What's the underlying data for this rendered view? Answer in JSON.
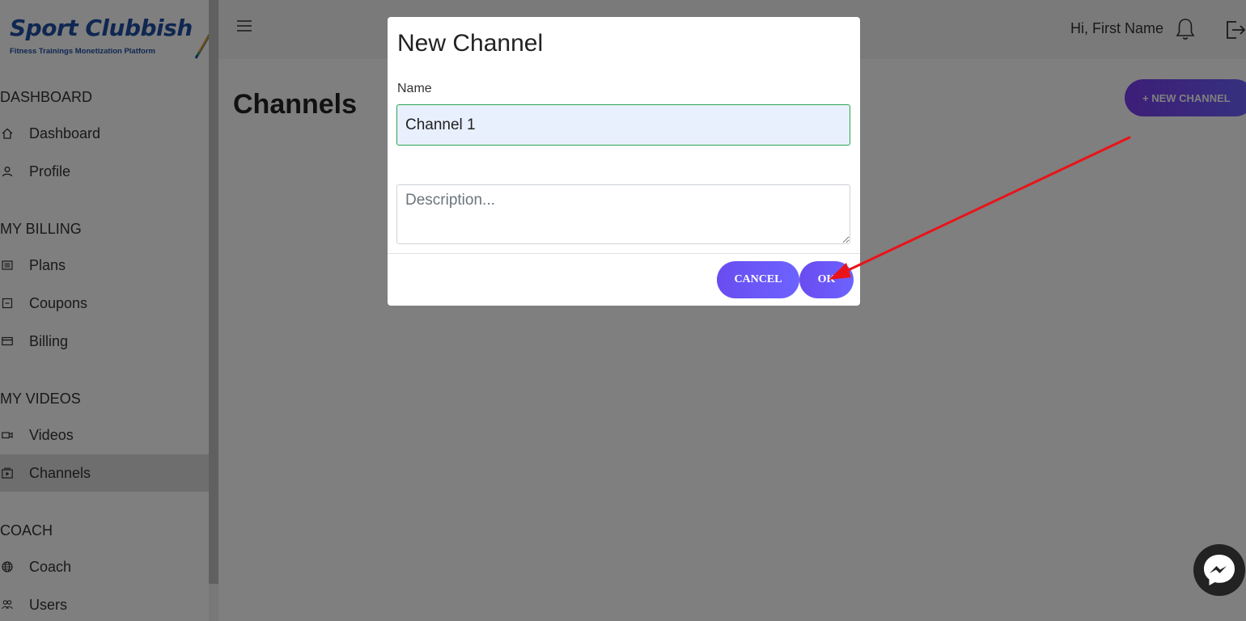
{
  "app": {
    "logo_title": "Sport Clubbish",
    "logo_tagline": "Fitness Trainings Monetization Platform"
  },
  "sidebar": {
    "sections": [
      {
        "label": "DASHBOARD"
      },
      {
        "label": "MY BILLING"
      },
      {
        "label": "MY VIDEOS"
      },
      {
        "label": "COACH"
      }
    ],
    "items": [
      {
        "label": "Dashboard",
        "icon": "home-icon"
      },
      {
        "label": "Profile",
        "icon": "user-icon"
      },
      {
        "label": "Plans",
        "icon": "list-icon"
      },
      {
        "label": "Coupons",
        "icon": "coupon-icon"
      },
      {
        "label": "Billing",
        "icon": "credit-card-icon"
      },
      {
        "label": "Videos",
        "icon": "video-camera-icon"
      },
      {
        "label": "Channels",
        "icon": "channel-icon",
        "active": true
      },
      {
        "label": "Coach",
        "icon": "globe-icon"
      },
      {
        "label": "Users",
        "icon": "users-icon"
      }
    ]
  },
  "topbar": {
    "greeting": "Hi, First Name"
  },
  "page": {
    "title": "Channels",
    "new_channel_label": "+ NEW CHANNEL"
  },
  "modal": {
    "title": "New Channel",
    "name_label": "Name",
    "name_value": "Channel 1",
    "description_placeholder": "Description...",
    "cancel_label": "CANCEL",
    "ok_label": "OK"
  },
  "colors": {
    "accent": "#6c63ff",
    "logo_blue": "#1f4fa3",
    "annotation_red": "#e8141a",
    "input_border_valid": "#2ea44f"
  }
}
